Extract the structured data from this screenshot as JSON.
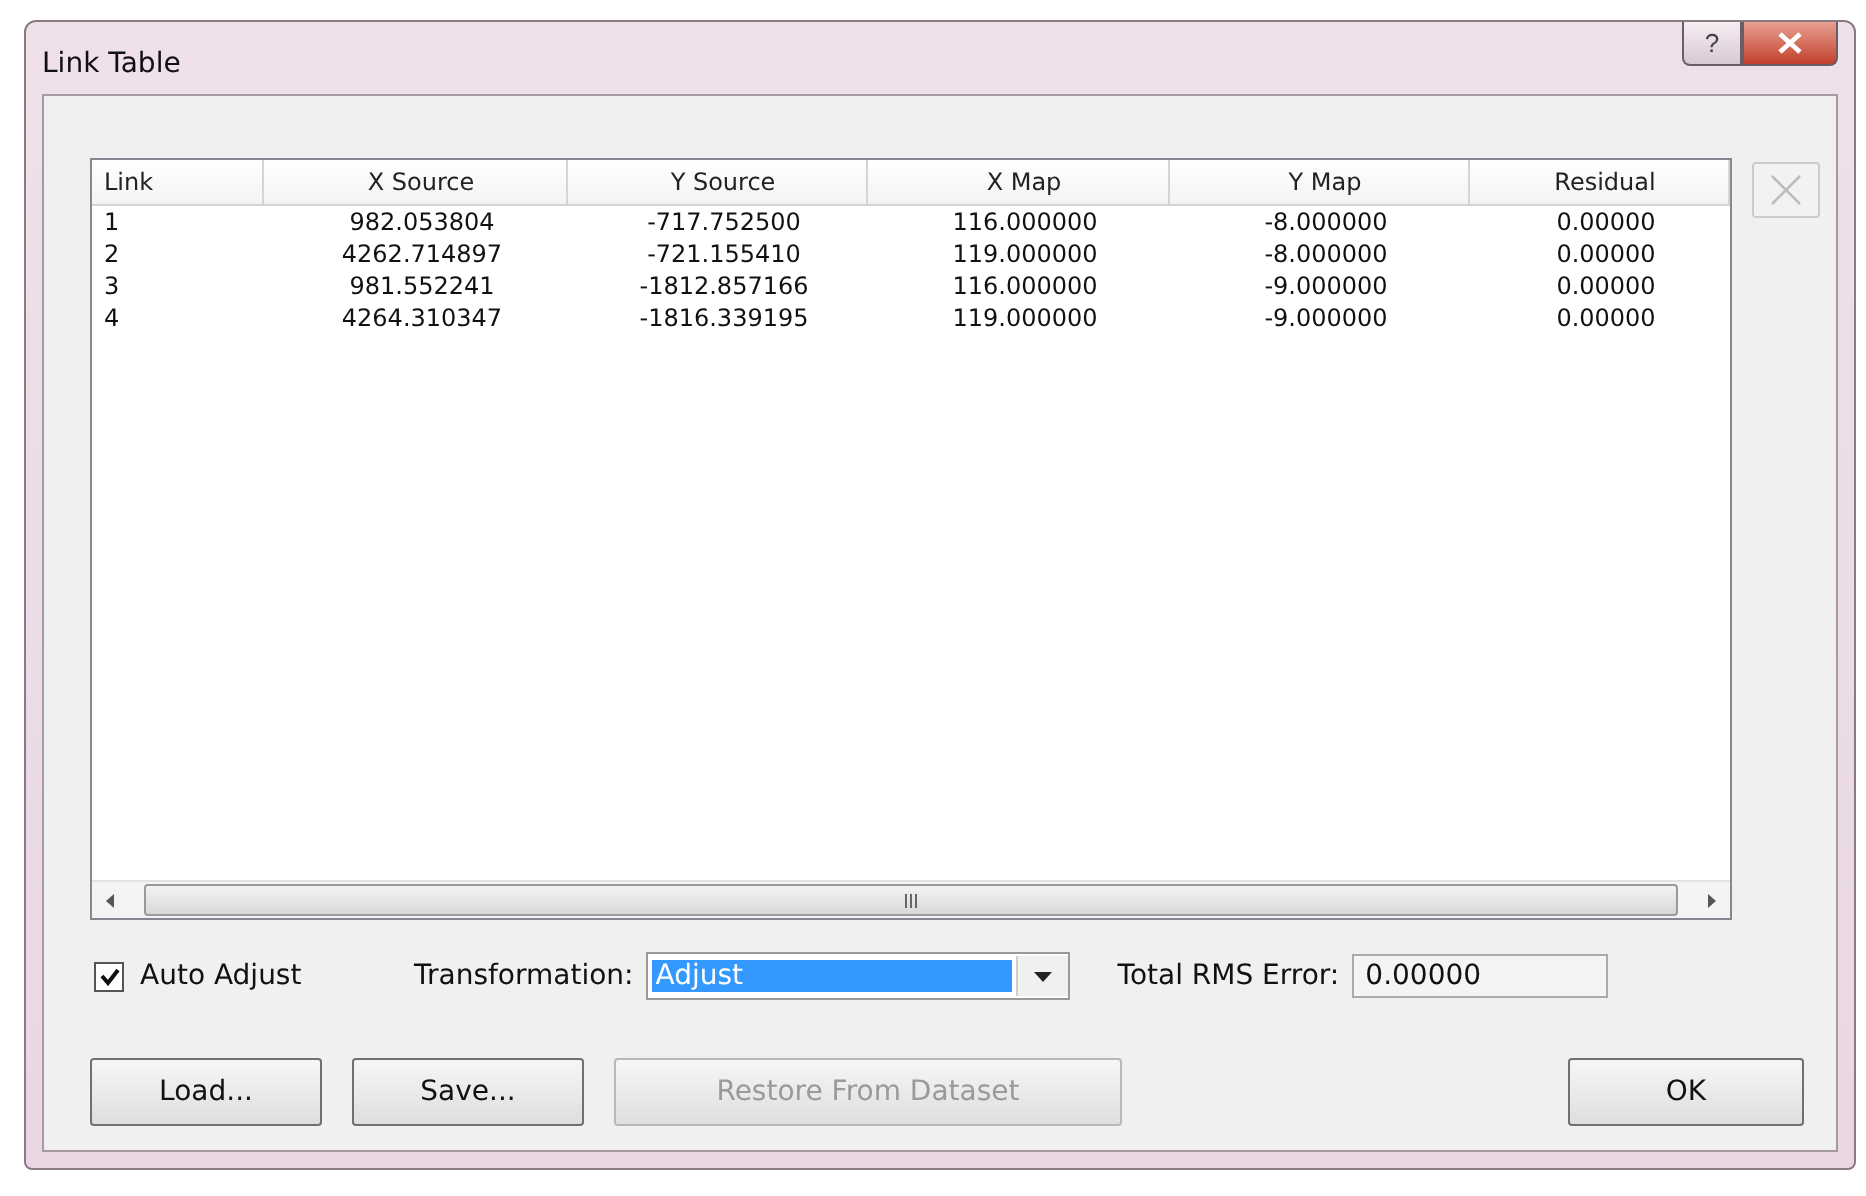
{
  "window": {
    "title": "Link Table",
    "help_button": "?"
  },
  "table": {
    "columns": [
      "Link",
      "X Source",
      "Y Source",
      "X Map",
      "Y Map",
      "Residual"
    ],
    "rows": [
      [
        "1",
        "982.053804",
        "-717.752500",
        "116.000000",
        "-8.000000",
        "0.00000"
      ],
      [
        "2",
        "4262.714897",
        "-721.155410",
        "119.000000",
        "-8.000000",
        "0.00000"
      ],
      [
        "3",
        "981.552241",
        "-1812.857166",
        "116.000000",
        "-9.000000",
        "0.00000"
      ],
      [
        "4",
        "4264.310347",
        "-1816.339195",
        "119.000000",
        "-9.000000",
        "0.00000"
      ]
    ]
  },
  "delete_button": {
    "disabled": true
  },
  "auto_adjust": {
    "label": "Auto Adjust",
    "checked": true
  },
  "transformation": {
    "label": "Transformation:",
    "value": "Adjust"
  },
  "rms": {
    "label": "Total RMS Error:",
    "value": "0.00000"
  },
  "buttons": [
    {
      "label": "Load...",
      "disabled": false
    },
    {
      "label": "Save...",
      "disabled": false
    },
    {
      "label": "Restore From Dataset",
      "disabled": true
    }
  ],
  "ok_button": {
    "label": "OK"
  }
}
